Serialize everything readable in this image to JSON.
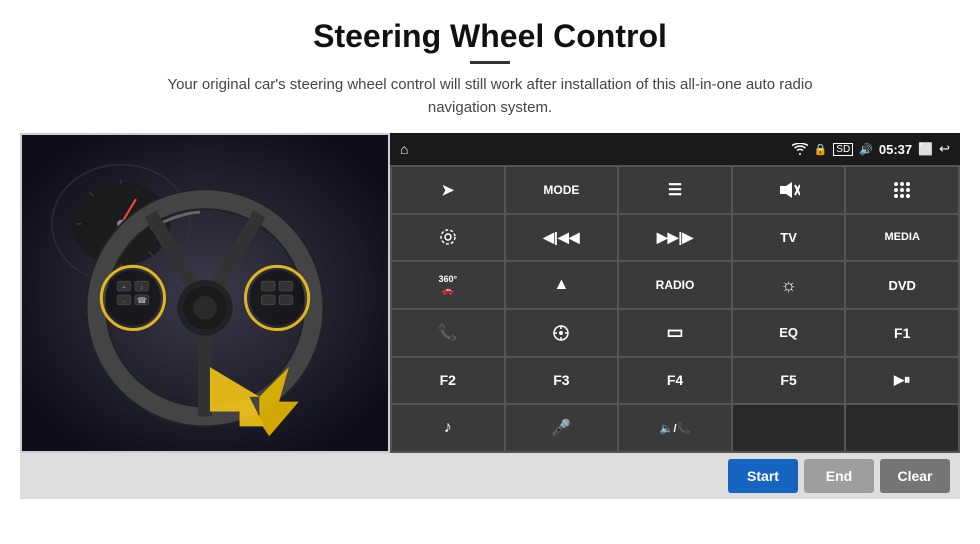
{
  "page": {
    "title": "Steering Wheel Control",
    "subtitle": "Your original car's steering wheel control will still work after installation of this all-in-one auto radio navigation system."
  },
  "statusBar": {
    "homeIcon": "⌂",
    "wifiIcon": "wifi",
    "lockIcon": "🔒",
    "sdIcon": "SD",
    "btIcon": "BT",
    "time": "05:37",
    "tvIcon": "TV",
    "backIcon": "↩"
  },
  "buttons": [
    {
      "id": "nav",
      "label": "➤",
      "span": 1,
      "row": 1
    },
    {
      "id": "mode",
      "label": "MODE",
      "span": 1,
      "row": 1
    },
    {
      "id": "list",
      "label": "≡",
      "span": 1,
      "row": 1
    },
    {
      "id": "mute",
      "label": "🔇",
      "span": 1,
      "row": 1
    },
    {
      "id": "apps",
      "label": "⊞",
      "span": 1,
      "row": 1
    },
    {
      "id": "settings",
      "label": "⚙",
      "span": 1,
      "row": 2
    },
    {
      "id": "prev",
      "label": "◀|◀◀",
      "span": 1,
      "row": 2
    },
    {
      "id": "next",
      "label": "▶▶|▶",
      "span": 1,
      "row": 2
    },
    {
      "id": "tv",
      "label": "TV",
      "span": 1,
      "row": 2
    },
    {
      "id": "media",
      "label": "MEDIA",
      "span": 1,
      "row": 2
    },
    {
      "id": "cam360",
      "label": "360°",
      "span": 1,
      "row": 3
    },
    {
      "id": "eject",
      "label": "▲",
      "span": 1,
      "row": 3
    },
    {
      "id": "radio",
      "label": "RADIO",
      "span": 1,
      "row": 3
    },
    {
      "id": "brightness",
      "label": "☼",
      "span": 1,
      "row": 3
    },
    {
      "id": "dvd",
      "label": "DVD",
      "span": 1,
      "row": 3
    },
    {
      "id": "phone",
      "label": "📞",
      "span": 1,
      "row": 4
    },
    {
      "id": "navi",
      "label": "🧭",
      "span": 1,
      "row": 4
    },
    {
      "id": "screen",
      "label": "▭",
      "span": 1,
      "row": 4
    },
    {
      "id": "eq",
      "label": "EQ",
      "span": 1,
      "row": 4
    },
    {
      "id": "f1",
      "label": "F1",
      "span": 1,
      "row": 4
    },
    {
      "id": "f2",
      "label": "F2",
      "span": 1,
      "row": 5
    },
    {
      "id": "f3",
      "label": "F3",
      "span": 1,
      "row": 5
    },
    {
      "id": "f4",
      "label": "F4",
      "span": 1,
      "row": 5
    },
    {
      "id": "f5",
      "label": "F5",
      "span": 1,
      "row": 5
    },
    {
      "id": "playpause",
      "label": "▶⏸",
      "span": 1,
      "row": 5
    },
    {
      "id": "music",
      "label": "♪",
      "span": 1,
      "row": 6
    },
    {
      "id": "mic",
      "label": "🎤",
      "span": 1,
      "row": 6
    },
    {
      "id": "volphone",
      "label": "🔈/📞",
      "span": 1,
      "row": 6
    }
  ],
  "actionBar": {
    "startLabel": "Start",
    "endLabel": "End",
    "clearLabel": "Clear"
  },
  "colors": {
    "accent": "#1565c0",
    "panelBg": "#2a2a2a",
    "btnBg": "#3a3a3a",
    "statusBg": "#1a1a1a",
    "actionBg": "#dddddd"
  }
}
